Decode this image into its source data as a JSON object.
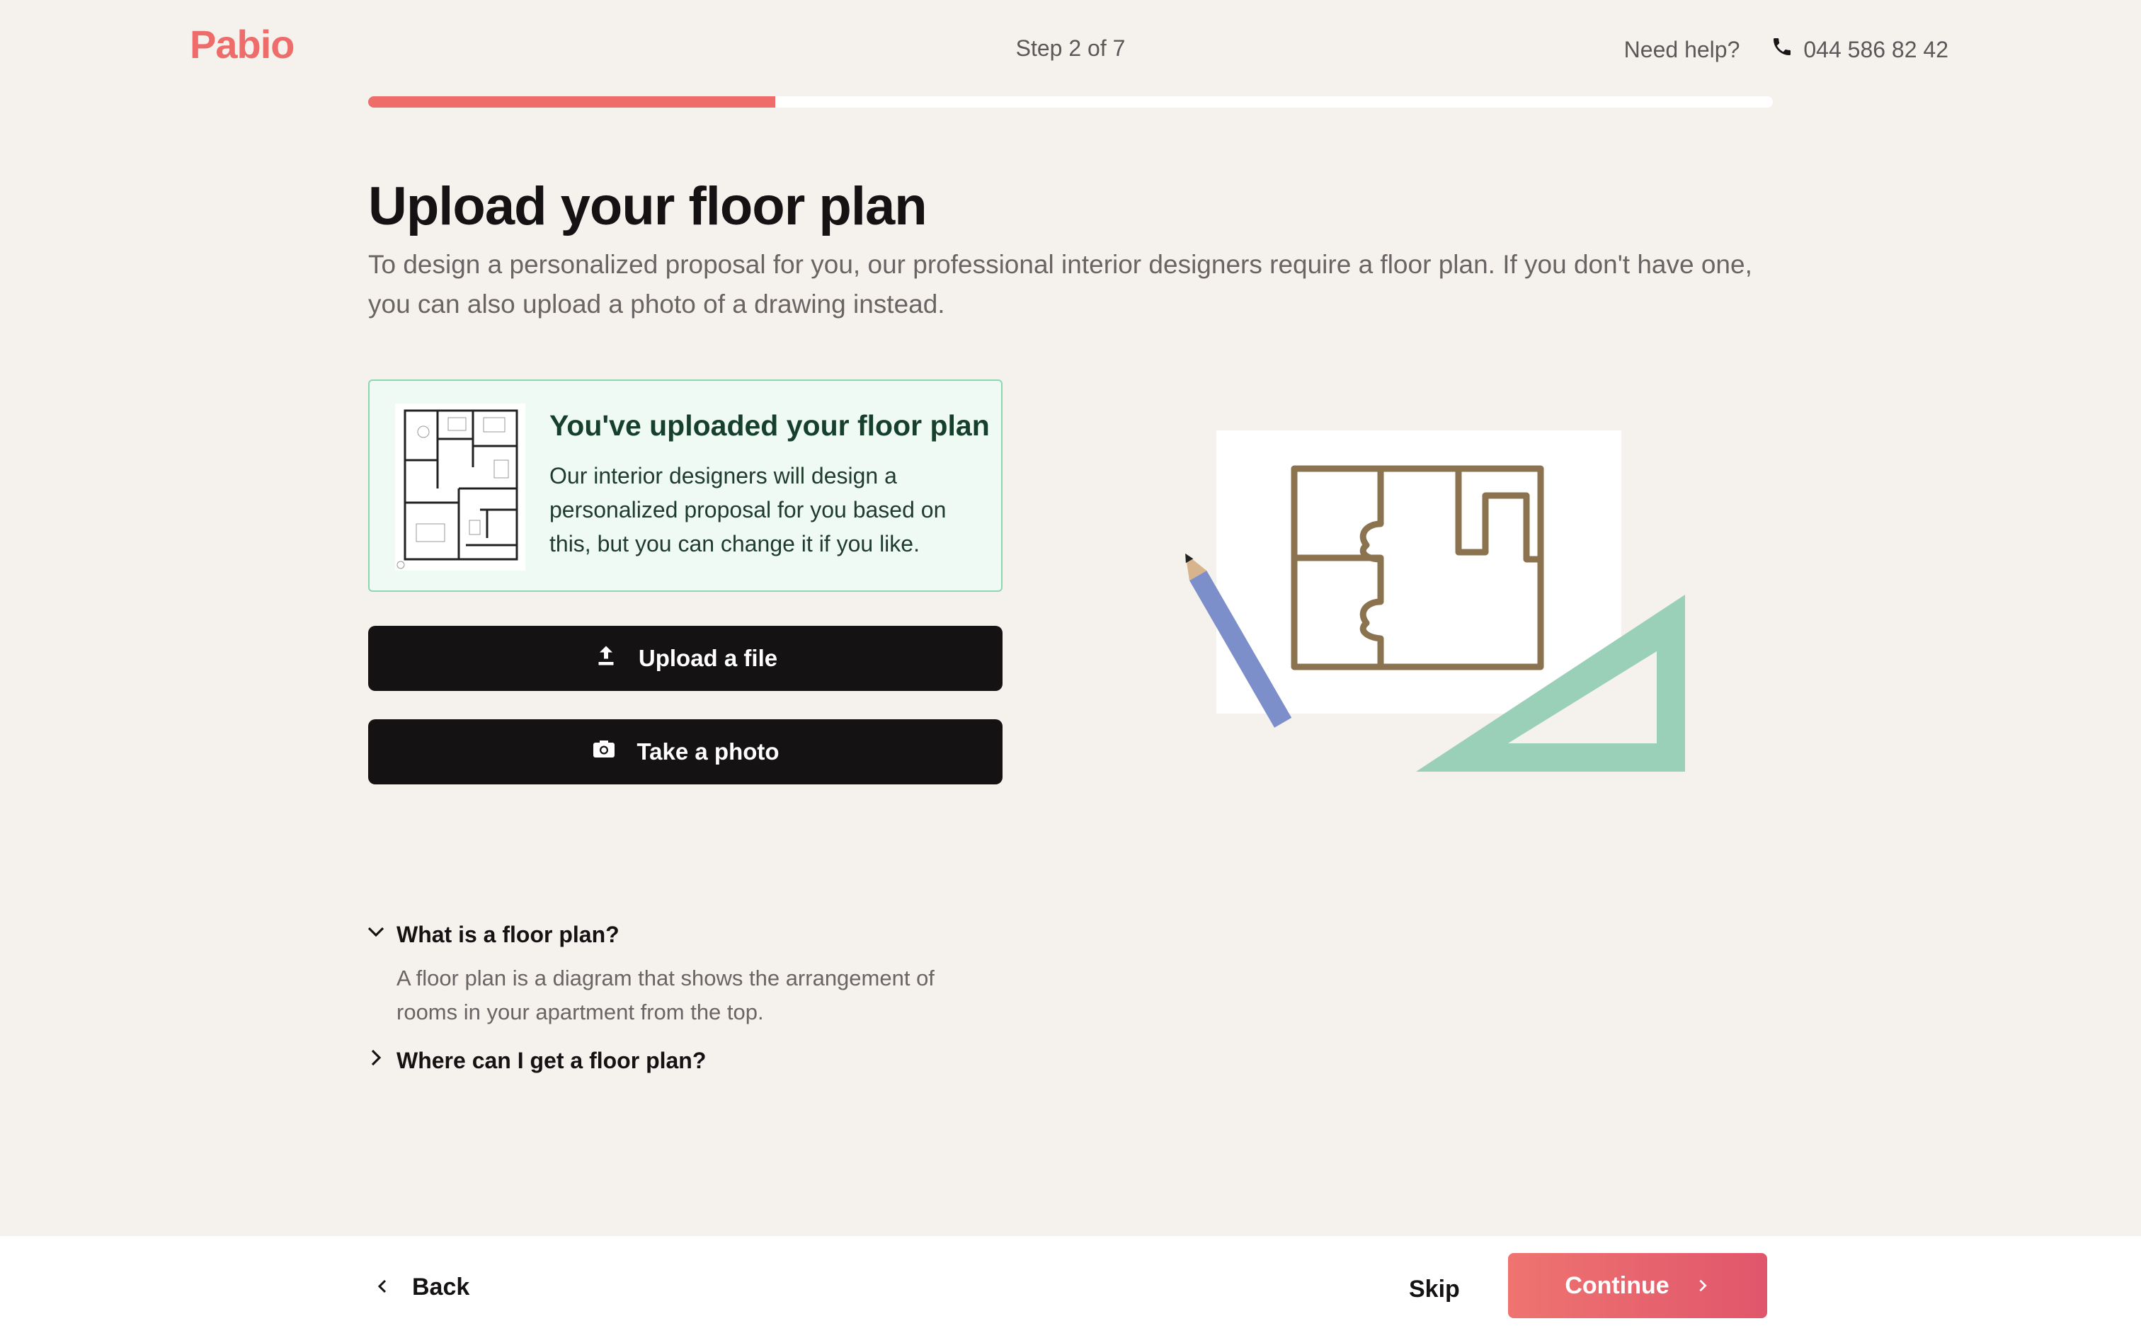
{
  "header": {
    "logo": "Pabio",
    "step_text": "Step 2 of 7",
    "help_text": "Need help?",
    "phone": "044 586 82 42",
    "progress_fraction": 0.29
  },
  "main": {
    "title": "Upload your floor plan",
    "subtitle": "To design a personalized proposal for you, our professional interior designers require a floor plan. If you don't have one, you can also upload a photo of a drawing instead.",
    "upload_card": {
      "title": "You've uploaded your floor plan",
      "text": "Our interior designers will design a personalized proposal for you based on this, but you can change it if you like."
    },
    "upload_button": "Upload a file",
    "photo_button": "Take a photo"
  },
  "faq": [
    {
      "question": "What is a floor plan?",
      "answer": "A floor plan is a diagram that shows the arrangement of rooms in your apartment from the top.",
      "expanded": true
    },
    {
      "question": "Where can I get a floor plan?",
      "answer": "",
      "expanded": false
    }
  ],
  "footer": {
    "back_label": "Back",
    "skip_label": "Skip",
    "continue_label": "Continue"
  },
  "colors": {
    "accent": "#ee6c6a",
    "background": "#f5f2ee",
    "dark_button": "#151213",
    "success_bg": "#eefaf3",
    "success_border": "#8fd6b0"
  },
  "icons": {
    "phone": "phone-icon",
    "upload": "upload-icon",
    "camera": "camera-icon",
    "chevron_down": "chevron-down-icon",
    "chevron_right": "chevron-right-icon",
    "chevron_left": "chevron-left-icon"
  }
}
